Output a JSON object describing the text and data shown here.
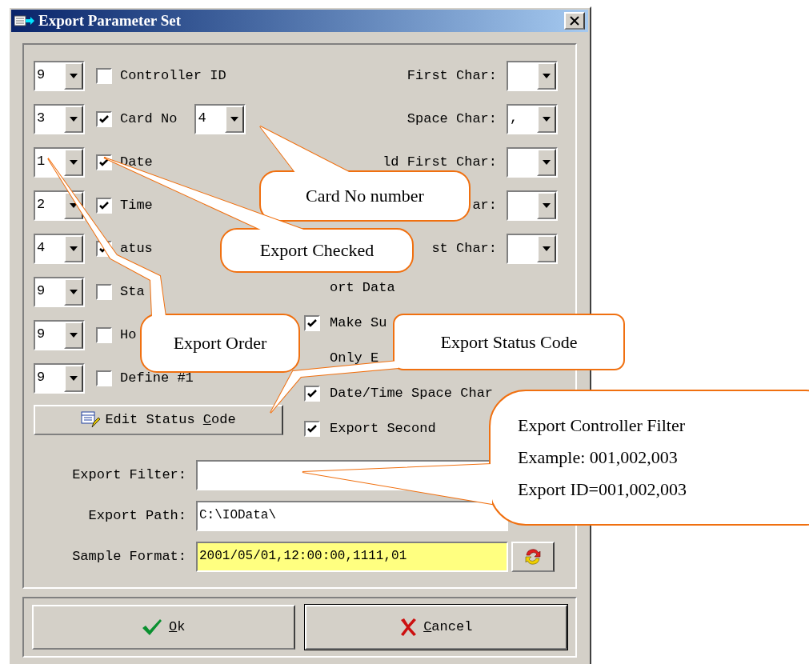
{
  "window": {
    "title": "Export Parameter Set"
  },
  "fields": [
    {
      "order": "9",
      "checked": false,
      "label": "Controller ID"
    },
    {
      "order": "3",
      "checked": true,
      "label": "Card No",
      "length": "4"
    },
    {
      "order": "1",
      "checked": true,
      "label": "Date"
    },
    {
      "order": "2",
      "checked": true,
      "label": "Time"
    },
    {
      "order": "4",
      "checked": true,
      "label": "atus"
    },
    {
      "order": "9",
      "checked": false,
      "label": "Sta"
    },
    {
      "order": "9",
      "checked": false,
      "label": "Ho"
    },
    {
      "order": "9",
      "checked": false,
      "label": "Define #1"
    }
  ],
  "separators": [
    {
      "label": "First Char:"
    },
    {
      "label": "Space Char:",
      "value": ","
    },
    {
      "label": "ld First Char:"
    },
    {
      "label": "ar:"
    },
    {
      "label": "st Char:"
    }
  ],
  "options": [
    {
      "kind": "text",
      "label": "ort Data"
    },
    {
      "kind": "checkbox",
      "checked": true,
      "label": "Make Su"
    },
    {
      "kind": "text",
      "label": "Only E"
    },
    {
      "kind": "checkbox",
      "checked": true,
      "label": "Date/Time Space Char"
    },
    {
      "kind": "checkbox",
      "checked": true,
      "label": "Export Second"
    }
  ],
  "edit_button": {
    "before": "Edit Status ",
    "mnemonic": "C",
    "after": "ode"
  },
  "inputs": [
    {
      "label": "Export Filter:",
      "highlighted": false
    },
    {
      "label": "Export Path:",
      "value": "C:\\IOData\\",
      "highlighted": false
    },
    {
      "label": "Sample Format:",
      "value": "2001/05/01,12:00:00,1111,01",
      "highlighted": true
    }
  ],
  "buttons": [
    {
      "kind": "ok",
      "mnemonic": "O",
      "after": "k"
    },
    {
      "kind": "cancel",
      "mnemonic": "C",
      "after": "ancel"
    }
  ],
  "callouts": [
    {
      "lines": [
        "Card No number"
      ]
    },
    {
      "lines": [
        "Export Checked"
      ]
    },
    {
      "lines": [
        "Export Order"
      ]
    },
    {
      "lines": [
        "Export Status Code"
      ]
    },
    {
      "lines": [
        "Export Controller Filter",
        "Example: 001,002,003",
        "Export ID=001,002,003"
      ]
    }
  ]
}
